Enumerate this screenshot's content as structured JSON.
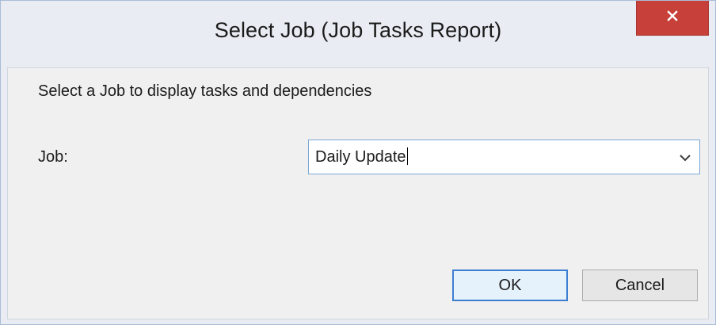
{
  "window": {
    "title": "Select Job (Job Tasks Report)",
    "close_icon": "close-icon",
    "accent_close": "#c7403a"
  },
  "dialog": {
    "prompt": "Select a Job to display tasks and dependencies",
    "job_label": "Job:",
    "job_select": {
      "value": "Daily Update",
      "icon": "chevron-down-icon"
    },
    "buttons": {
      "ok_label": "OK",
      "cancel_label": "Cancel"
    }
  }
}
